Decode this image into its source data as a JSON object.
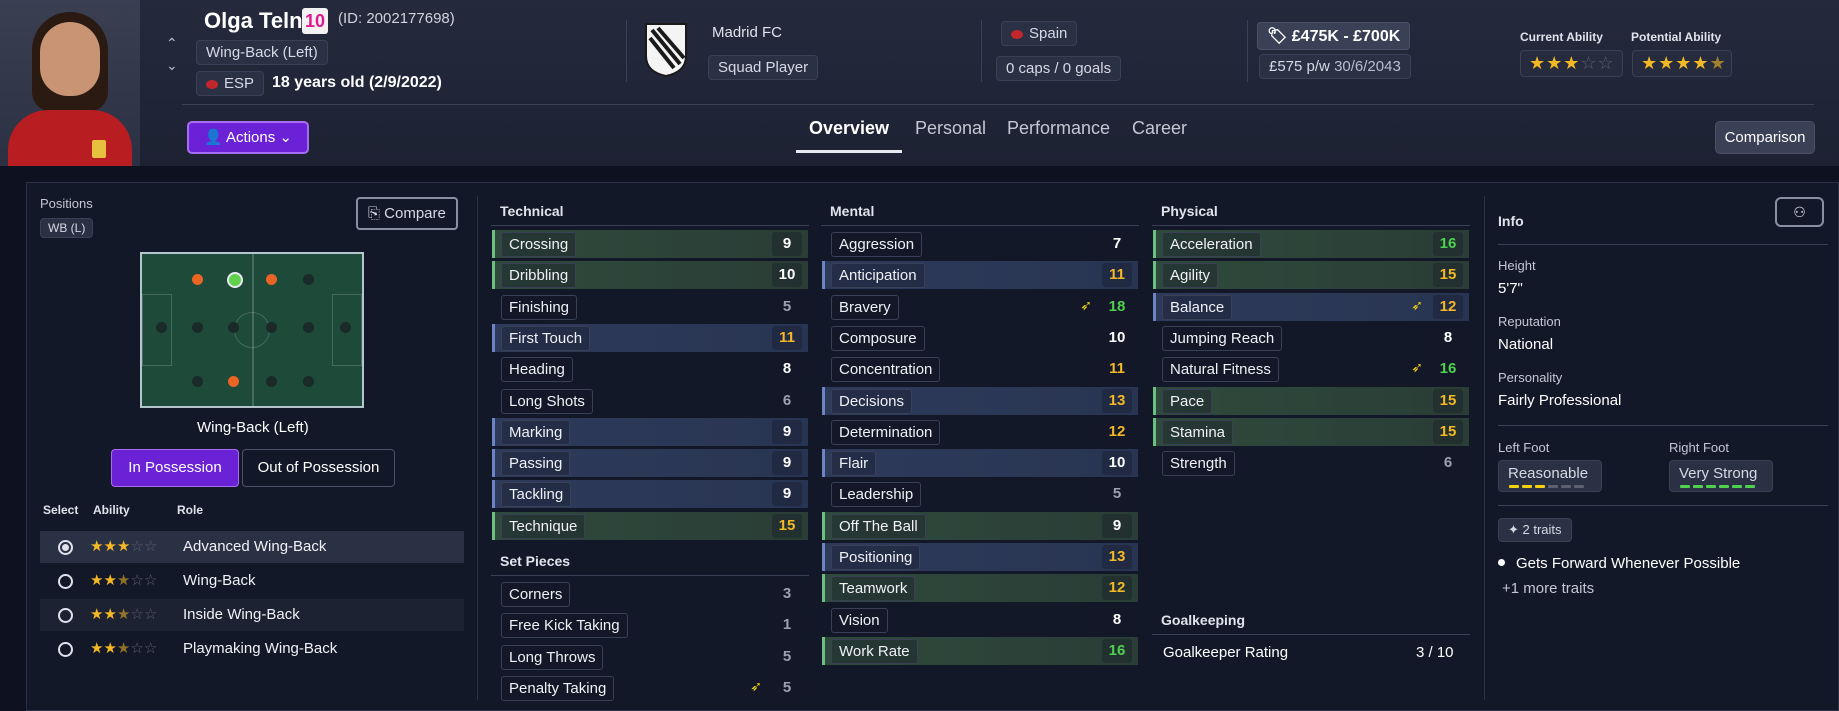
{
  "header": {
    "name": "Olga Telna",
    "number": "10",
    "id": "(ID: 2002177698)",
    "position": "Wing-Back (Left)",
    "nation_code": "ESP",
    "age": "18 years old (2/9/2022)",
    "club": "Madrid FC",
    "squad_status": "Squad Player",
    "country": "Spain",
    "caps": "0 caps / 0 goals",
    "value": "£475K - £700K",
    "wage": "£575 p/w",
    "contract": "30/6/2043",
    "ca_label": "Current Ability",
    "pa_label": "Potential Ability",
    "ca_stars": 3,
    "pa_stars": 4.5,
    "actions_label": "Actions",
    "comparison_label": "Comparison",
    "tabs": [
      "Overview",
      "Personal",
      "Performance",
      "Career"
    ],
    "active_tab": "Overview"
  },
  "positions": {
    "title": "Positions",
    "badge": "WB (L)",
    "compare_label": "Compare",
    "pitch_caption": "Wing-Back (Left)",
    "in_possession": "In Possession",
    "out_possession": "Out of Possession",
    "col_select": "Select",
    "col_ability": "Ability",
    "col_role": "Role",
    "roles": [
      {
        "name": "Advanced Wing-Back",
        "stars": 3,
        "selected": true
      },
      {
        "name": "Wing-Back",
        "stars": 2.5,
        "selected": false
      },
      {
        "name": "Inside Wing-Back",
        "stars": 2.5,
        "selected": false
      },
      {
        "name": "Playmaking Wing-Back",
        "stars": 2.5,
        "selected": false
      }
    ]
  },
  "technical": {
    "title": "Technical",
    "rows": [
      {
        "label": "Crossing",
        "value": "9",
        "hl": "green"
      },
      {
        "label": "Dribbling",
        "value": "10",
        "hl": "green"
      },
      {
        "label": "Finishing",
        "value": "5",
        "hl": ""
      },
      {
        "label": "First Touch",
        "value": "11",
        "hl": "blue"
      },
      {
        "label": "Heading",
        "value": "8",
        "hl": ""
      },
      {
        "label": "Long Shots",
        "value": "6",
        "hl": ""
      },
      {
        "label": "Marking",
        "value": "9",
        "hl": "blue"
      },
      {
        "label": "Passing",
        "value": "9",
        "hl": "blue"
      },
      {
        "label": "Tackling",
        "value": "9",
        "hl": "blue"
      },
      {
        "label": "Technique",
        "value": "15",
        "hl": "green"
      }
    ]
  },
  "setpieces": {
    "title": "Set Pieces",
    "rows": [
      {
        "label": "Corners",
        "value": "3",
        "hl": ""
      },
      {
        "label": "Free Kick Taking",
        "value": "1",
        "hl": ""
      },
      {
        "label": "Long Throws",
        "value": "5",
        "hl": ""
      },
      {
        "label": "Penalty Taking",
        "value": "5",
        "hl": "",
        "trait": true
      }
    ]
  },
  "mental": {
    "title": "Mental",
    "rows": [
      {
        "label": "Aggression",
        "value": "7",
        "hl": ""
      },
      {
        "label": "Anticipation",
        "value": "11",
        "hl": "blue"
      },
      {
        "label": "Bravery",
        "value": "18",
        "hl": "",
        "trait": true
      },
      {
        "label": "Composure",
        "value": "10",
        "hl": ""
      },
      {
        "label": "Concentration",
        "value": "11",
        "hl": ""
      },
      {
        "label": "Decisions",
        "value": "13",
        "hl": "blue"
      },
      {
        "label": "Determination",
        "value": "12",
        "hl": ""
      },
      {
        "label": "Flair",
        "value": "10",
        "hl": "blue"
      },
      {
        "label": "Leadership",
        "value": "5",
        "hl": ""
      },
      {
        "label": "Off The Ball",
        "value": "9",
        "hl": "green"
      },
      {
        "label": "Positioning",
        "value": "13",
        "hl": "blue"
      },
      {
        "label": "Teamwork",
        "value": "12",
        "hl": "green"
      },
      {
        "label": "Vision",
        "value": "8",
        "hl": ""
      },
      {
        "label": "Work Rate",
        "value": "16",
        "hl": "green"
      }
    ]
  },
  "physical": {
    "title": "Physical",
    "rows": [
      {
        "label": "Acceleration",
        "value": "16",
        "hl": "green"
      },
      {
        "label": "Agility",
        "value": "15",
        "hl": "green"
      },
      {
        "label": "Balance",
        "value": "12",
        "hl": "blue",
        "trait": true
      },
      {
        "label": "Jumping Reach",
        "value": "8",
        "hl": ""
      },
      {
        "label": "Natural Fitness",
        "value": "16",
        "hl": "",
        "trait": true
      },
      {
        "label": "Pace",
        "value": "15",
        "hl": "green"
      },
      {
        "label": "Stamina",
        "value": "15",
        "hl": "green"
      },
      {
        "label": "Strength",
        "value": "6",
        "hl": ""
      }
    ]
  },
  "goalkeeping": {
    "title": "Goalkeeping",
    "label": "Goalkeeper Rating",
    "value": "3 / 10"
  },
  "info": {
    "title": "Info",
    "height_label": "Height",
    "height": "5'7\"",
    "reputation_label": "Reputation",
    "reputation": "National",
    "personality_label": "Personality",
    "personality": "Fairly Professional",
    "left_foot_label": "Left Foot",
    "left_foot": "Reasonable",
    "left_foot_level": 3,
    "right_foot_label": "Right Foot",
    "right_foot": "Very Strong",
    "right_foot_level": 6,
    "traits_label": "2 traits",
    "trait_1": "Gets Forward Whenever Possible",
    "more_traits": "+1 more traits"
  }
}
